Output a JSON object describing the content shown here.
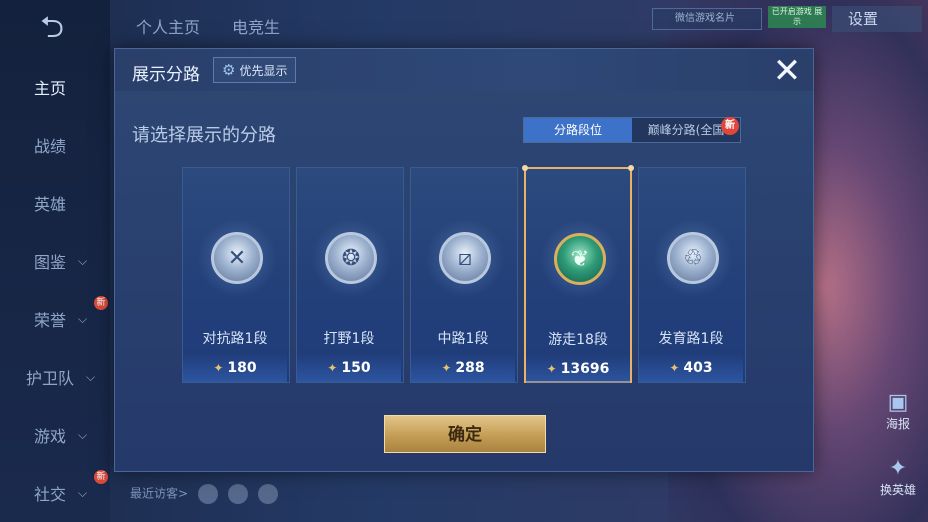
{
  "sidebar": {
    "items": [
      {
        "label": "主页",
        "active": true
      },
      {
        "label": "战绩"
      },
      {
        "label": "英雄"
      },
      {
        "label": "图鉴",
        "chevron": true
      },
      {
        "label": "荣誉",
        "chevron": true,
        "new": "新"
      },
      {
        "label": "护卫队",
        "chevron": true
      },
      {
        "label": "游戏",
        "chevron": true
      },
      {
        "label": "社交",
        "chevron": true,
        "new": "新"
      }
    ]
  },
  "header": {
    "tabs": [
      "个人主页",
      "电竞生"
    ],
    "card_label": "微信游戏名片",
    "badge_text": "已开启游戏 展示",
    "settings_label": "设置"
  },
  "right_rail": {
    "haibao_label": "海报",
    "huan_label": "换英雄"
  },
  "footer": {
    "recent_visitors_label": "最近访客>"
  },
  "modal": {
    "title": "展示分路",
    "priority_label": "优先显示",
    "prompt": "请选择展示的分路",
    "tabs": [
      {
        "label": "分路段位",
        "active": true
      },
      {
        "label": "巅峰分路(全国"
      }
    ],
    "new_badge": "新",
    "cards": [
      {
        "rank": "对抗路1段",
        "points": "180",
        "icon": "sword-cross-icon"
      },
      {
        "rank": "打野1段",
        "points": "150",
        "icon": "dragon-icon"
      },
      {
        "rank": "中路1段",
        "points": "288",
        "icon": "slash-icon"
      },
      {
        "rank": "游走18段",
        "points": "13696",
        "icon": "wings-emblem-icon",
        "selected": true
      },
      {
        "rank": "发育路1段",
        "points": "403",
        "icon": "swirl-icon"
      }
    ],
    "confirm_label": "确定"
  },
  "colors": {
    "accent": "#3d72c8",
    "selected_border": "#e8b26a",
    "confirm_gold": "#c49d55"
  }
}
